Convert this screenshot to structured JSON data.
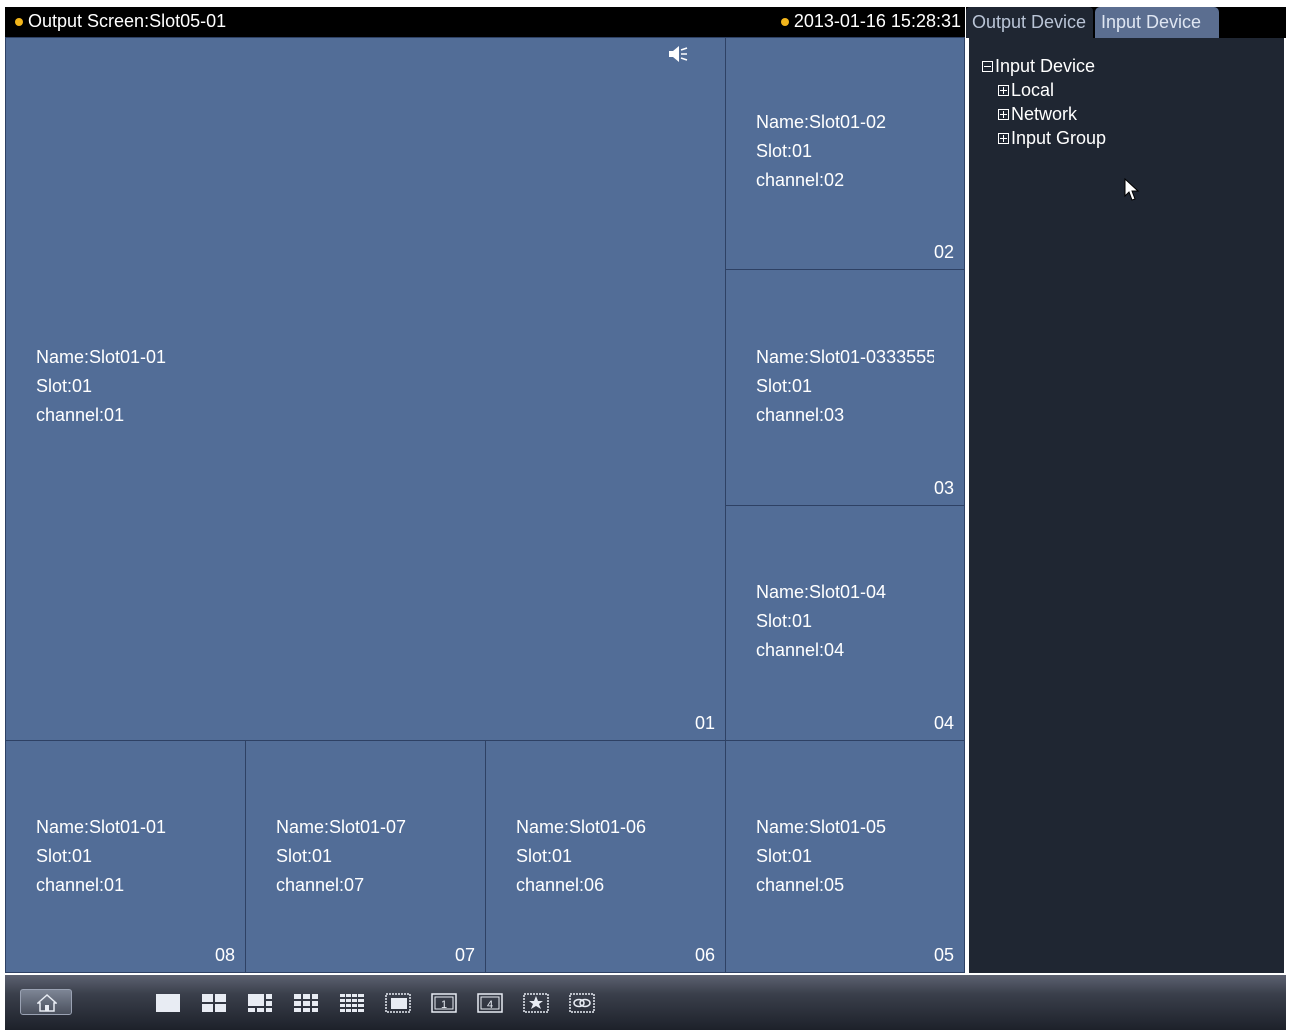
{
  "header": {
    "output_screen": "Output Screen:Slot05-01",
    "datetime": "2013-01-16 15:28:31",
    "status_color": "#f2b51b"
  },
  "tabs": [
    {
      "label": "Output Device",
      "active": false
    },
    {
      "label": "Input Device",
      "active": true
    }
  ],
  "tree": {
    "root": "Input Device",
    "children": [
      "Local",
      "Network",
      "Input Group"
    ]
  },
  "cells": [
    {
      "name": "Name:Slot01-01",
      "slot": "Slot:01",
      "channel": "channel:01",
      "num": "01"
    },
    {
      "name": "Name:Slot01-02",
      "slot": "Slot:01",
      "channel": "channel:02",
      "num": "02"
    },
    {
      "name": "Name:Slot01-0333555",
      "slot": "Slot:01",
      "channel": "channel:03",
      "num": "03"
    },
    {
      "name": "Name:Slot01-04",
      "slot": "Slot:01",
      "channel": "channel:04",
      "num": "04"
    },
    {
      "name": "Name:Slot01-05",
      "slot": "Slot:01",
      "channel": "channel:05",
      "num": "05"
    },
    {
      "name": "Name:Slot01-06",
      "slot": "Slot:01",
      "channel": "channel:06",
      "num": "06"
    },
    {
      "name": "Name:Slot01-07",
      "slot": "Slot:01",
      "channel": "channel:07",
      "num": "07"
    },
    {
      "name": "Name:Slot01-01",
      "slot": "Slot:01",
      "channel": "channel:01",
      "num": "08"
    }
  ],
  "toolbar": {
    "icons": [
      "home-icon",
      "layout-1-icon",
      "layout-4-icon",
      "layout-6-icon",
      "layout-9-icon",
      "layout-16-icon",
      "pip-icon",
      "single-screen-icon",
      "four-screen-icon",
      "favorite-icon",
      "link-icon"
    ]
  }
}
